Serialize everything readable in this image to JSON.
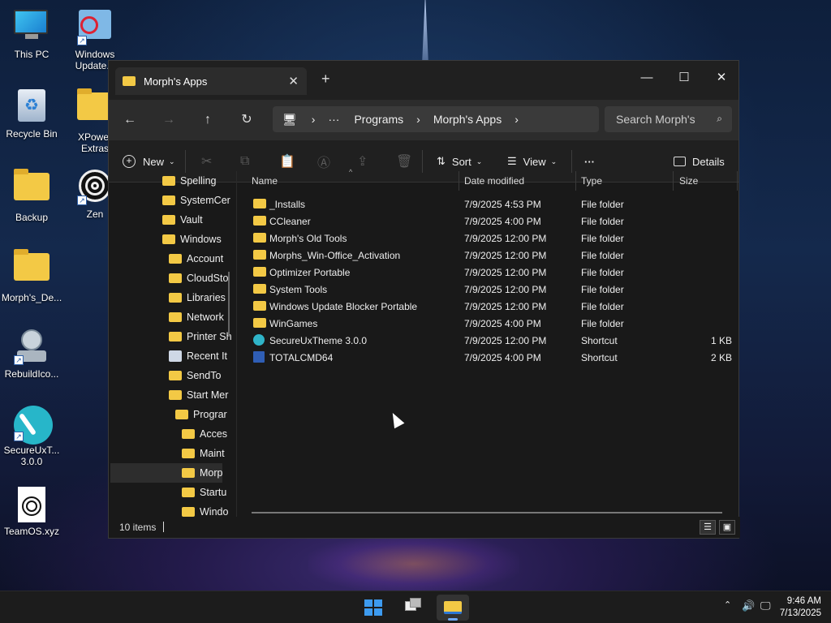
{
  "desktop": {
    "icons": [
      {
        "label": "This PC",
        "icon": "monitor-icon"
      },
      {
        "label": "Windows Update...",
        "icon": "windows-update-icon"
      },
      {
        "label": "Recycle Bin",
        "icon": "recycle-bin-icon"
      },
      {
        "label": "XPower Extras",
        "icon": "folder-icon"
      },
      {
        "label": "Backup",
        "icon": "folder-icon"
      },
      {
        "label": "Zen",
        "icon": "zen-icon"
      },
      {
        "label": "Morph's_De...",
        "icon": "folder-icon"
      },
      {
        "label": "RebuildIco...",
        "icon": "robot-icon"
      },
      {
        "label": "SecureUxT... 3.0.0",
        "icon": "brush-icon"
      },
      {
        "label": "TeamOS.xyz",
        "icon": "document-icon"
      }
    ]
  },
  "window": {
    "tab_title": "Morph's Apps",
    "address": {
      "segments": [
        "Programs",
        "Morph's Apps"
      ],
      "more": "···"
    },
    "search_placeholder": "Search Morph's",
    "commands": {
      "new": "New",
      "sort": "Sort",
      "view": "View",
      "more": "···",
      "details": "Details"
    },
    "nav_tree": [
      {
        "label": "Spelling",
        "icon": "folder"
      },
      {
        "label": "SystemCer",
        "icon": "folder"
      },
      {
        "label": "Vault",
        "icon": "folder"
      },
      {
        "label": "Windows",
        "icon": "folder"
      },
      {
        "label": "Account",
        "icon": "folder"
      },
      {
        "label": "CloudSto",
        "icon": "folder"
      },
      {
        "label": "Libraries",
        "icon": "folder"
      },
      {
        "label": "Network",
        "icon": "folder"
      },
      {
        "label": "Printer Sh",
        "icon": "folder"
      },
      {
        "label": "Recent It",
        "icon": "recent"
      },
      {
        "label": "SendTo",
        "icon": "folder"
      },
      {
        "label": "Start Mer",
        "icon": "folder"
      },
      {
        "label": "Prograr",
        "icon": "folder"
      },
      {
        "label": "Acces",
        "icon": "folder"
      },
      {
        "label": "Maint",
        "icon": "folder"
      },
      {
        "label": "Morp",
        "icon": "folder"
      },
      {
        "label": "Startu",
        "icon": "folder"
      },
      {
        "label": "Windo",
        "icon": "folder"
      }
    ],
    "columns": {
      "name": "Name",
      "date": "Date modified",
      "type": "Type",
      "size": "Size"
    },
    "files": [
      {
        "name": "_Installs",
        "date": "7/9/2025 4:53 PM",
        "type": "File folder",
        "size": "",
        "icon": "folder"
      },
      {
        "name": "CCleaner",
        "date": "7/9/2025 4:00 PM",
        "type": "File folder",
        "size": "",
        "icon": "folder"
      },
      {
        "name": "Morph's Old Tools",
        "date": "7/9/2025 12:00 PM",
        "type": "File folder",
        "size": "",
        "icon": "folder"
      },
      {
        "name": "Morphs_Win-Office_Activation",
        "date": "7/9/2025 12:00 PM",
        "type": "File folder",
        "size": "",
        "icon": "folder"
      },
      {
        "name": "Optimizer Portable",
        "date": "7/9/2025 12:00 PM",
        "type": "File folder",
        "size": "",
        "icon": "folder"
      },
      {
        "name": "System Tools",
        "date": "7/9/2025 12:00 PM",
        "type": "File folder",
        "size": "",
        "icon": "folder"
      },
      {
        "name": "Windows Update Blocker Portable",
        "date": "7/9/2025 12:00 PM",
        "type": "File folder",
        "size": "",
        "icon": "folder"
      },
      {
        "name": "WinGames",
        "date": "7/9/2025 4:00 PM",
        "type": "File folder",
        "size": "",
        "icon": "folder"
      },
      {
        "name": "SecureUxTheme 3.0.0",
        "date": "7/9/2025 12:00 PM",
        "type": "Shortcut",
        "size": "1 KB",
        "icon": "shortcut-secureux"
      },
      {
        "name": "TOTALCMD64",
        "date": "7/9/2025 4:00 PM",
        "type": "Shortcut",
        "size": "2 KB",
        "icon": "shortcut-totalcmd"
      }
    ],
    "status": {
      "item_count": "10 items"
    }
  },
  "taskbar": {
    "clock_time": "9:46 AM",
    "clock_date": "7/13/2025"
  },
  "colors": {
    "folder": "#f3c945",
    "window_bg": "#191919",
    "accent": "#6fa9ff"
  }
}
